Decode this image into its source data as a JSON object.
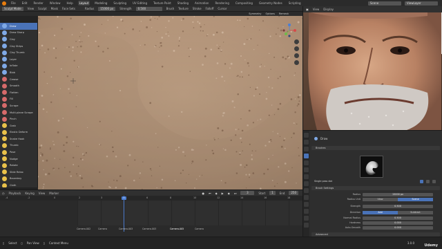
{
  "topbar": {
    "menus": [
      "File",
      "Edit",
      "Render",
      "Window",
      "Help"
    ],
    "workspace_tabs": [
      {
        "label": "Layout",
        "active": true
      },
      {
        "label": "Modeling",
        "active": false
      },
      {
        "label": "Sculpting",
        "active": false
      },
      {
        "label": "UV Editing",
        "active": false
      },
      {
        "label": "Texture Paint",
        "active": false
      },
      {
        "label": "Shading",
        "active": false
      },
      {
        "label": "Animation",
        "active": false
      },
      {
        "label": "Rendering",
        "active": false
      },
      {
        "label": "Compositing",
        "active": false
      },
      {
        "label": "Geometry Nodes",
        "active": false
      },
      {
        "label": "Scripting",
        "active": false
      }
    ],
    "scene_label": "Scene",
    "view_layer_label": "ViewLayer"
  },
  "viewport_header": {
    "mode": "Sculpt Mode",
    "menus": [
      "View",
      "Sculpt",
      "Mask",
      "Face Sets"
    ],
    "radius_label": "Radius",
    "radius_value": "15000 px",
    "strength_label": "Strength",
    "strength_value": "0.500",
    "dropdowns": [
      "Brush",
      "Texture",
      "Stroke",
      "Falloff",
      "Cursor"
    ]
  },
  "viewport_subheader": [
    "Symmetry",
    "Options",
    "Remesh"
  ],
  "tools": [
    {
      "label": "Draw",
      "active": true,
      "color": "#7fa9e6"
    },
    {
      "label": "Draw Sharp",
      "active": false,
      "color": "#7fa9e6"
    },
    {
      "label": "Clay",
      "active": false,
      "color": "#7fa9e6"
    },
    {
      "label": "Clay Strips",
      "active": false,
      "color": "#7fa9e6"
    },
    {
      "label": "Clay Thumb",
      "active": false,
      "color": "#7fa9e6"
    },
    {
      "label": "Layer",
      "active": false,
      "color": "#7fa9e6"
    },
    {
      "label": "Inflate",
      "active": false,
      "color": "#7fa9e6"
    },
    {
      "label": "Blob",
      "active": false,
      "color": "#7fa9e6"
    },
    {
      "label": "Crease",
      "active": false,
      "color": "#d66a6a"
    },
    {
      "label": "Smooth",
      "active": false,
      "color": "#d66a6a"
    },
    {
      "label": "Flatten",
      "active": false,
      "color": "#d66a6a"
    },
    {
      "label": "Fill",
      "active": false,
      "color": "#d66a6a"
    },
    {
      "label": "Scrape",
      "active": false,
      "color": "#d66a6a"
    },
    {
      "label": "Multi-plane Scrape",
      "active": false,
      "color": "#d66a6a"
    },
    {
      "label": "Pinch",
      "active": false,
      "color": "#d66a6a"
    },
    {
      "label": "Grab",
      "active": false,
      "color": "#e9c14a"
    },
    {
      "label": "Elastic Deform",
      "active": false,
      "color": "#e9c14a"
    },
    {
      "label": "Snake Hook",
      "active": false,
      "color": "#e9c14a"
    },
    {
      "label": "Thumb",
      "active": false,
      "color": "#e9c14a"
    },
    {
      "label": "Pose",
      "active": false,
      "color": "#e9c14a"
    },
    {
      "label": "Nudge",
      "active": false,
      "color": "#e9c14a"
    },
    {
      "label": "Rotate",
      "active": false,
      "color": "#e9c14a"
    },
    {
      "label": "Slide Relax",
      "active": false,
      "color": "#e9c14a"
    },
    {
      "label": "Boundary",
      "active": false,
      "color": "#e9c14a"
    },
    {
      "label": "Cloth",
      "active": false,
      "color": "#e9c14a"
    }
  ],
  "timeline": {
    "menus": [
      "Playback",
      "Keying",
      "View",
      "Marker"
    ],
    "current_frame": "3",
    "start_label": "Start",
    "start_value": "1",
    "end_label": "End",
    "end_value": "250",
    "ruler": [
      "-4",
      "-2",
      "0",
      "2",
      "3",
      "4",
      "6",
      "8",
      "10",
      "12",
      "14",
      "16",
      "18",
      "20",
      "22"
    ],
    "markers": [
      "Camera.002",
      "Camera",
      "Camera.003",
      "Camera.003",
      "Camera.005",
      "Camera"
    ]
  },
  "video_panel": {
    "view_label": "View",
    "display_label": "Display"
  },
  "properties": {
    "brush_name": "Draw",
    "brushes_panel": "Brushes",
    "brush_settings_panel": "Brush Settings",
    "advanced_panel": "Advanced",
    "brush_field": "Single pass dot",
    "radius_label": "Radius",
    "radius_value": "15000 px",
    "radius_unit_label": "Radius Unit",
    "radius_unit_options": [
      {
        "label": "View",
        "on": false
      },
      {
        "label": "Scene",
        "on": true
      }
    ],
    "strength_label": "Strength",
    "strength_value": "0.500",
    "direction_label": "Direction",
    "direction_options": [
      {
        "label": "Add",
        "on": true
      },
      {
        "label": "Subtract",
        "on": false
      }
    ],
    "normal_radius_label": "Normal Radius",
    "normal_radius_value": "0.500",
    "hardness_label": "Hardness",
    "hardness_value": "0.000",
    "auto_smooth_label": "Auto-Smooth",
    "auto_smooth_value": "0.000"
  },
  "statusbar": {
    "items": [
      "Select",
      "Pan View",
      "Context Menu"
    ],
    "version": "3.0.0"
  },
  "watermark": "Udemy"
}
